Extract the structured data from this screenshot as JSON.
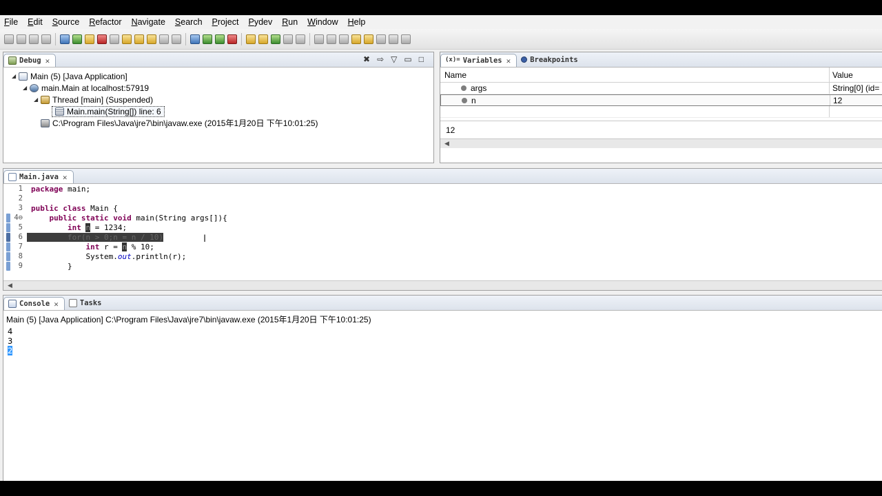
{
  "menu": [
    "File",
    "Edit",
    "Source",
    "Refactor",
    "Navigate",
    "Search",
    "Project",
    "Pydev",
    "Run",
    "Window",
    "Help"
  ],
  "debug_view": {
    "tab_label": "Debug",
    "tree": [
      {
        "label": "Main (5) [Java Application]"
      },
      {
        "label": "main.Main at localhost:57919"
      },
      {
        "label": "Thread [main] (Suspended)"
      },
      {
        "label": "Main.main(String[]) line: 6"
      },
      {
        "label": "C:\\Program Files\\Java\\jre7\\bin\\javaw.exe (2015年1月20日 下午10:01:25)"
      }
    ]
  },
  "variables_view": {
    "tab_label": "Variables",
    "breakpoints_label": "Breakpoints",
    "col_name": "Name",
    "col_value": "Value",
    "rows": [
      {
        "name": "args",
        "value": "String[0]  (id="
      },
      {
        "name": "n",
        "value": "12"
      }
    ],
    "detail": "12"
  },
  "editor": {
    "tab_label": "Main.java",
    "lines": [
      {
        "num": "1",
        "text": "package main;"
      },
      {
        "num": "2",
        "text": ""
      },
      {
        "num": "3",
        "pre": "public class",
        "text": " Main {"
      },
      {
        "num": "4⊖",
        "pre": "    public static void",
        "text": " main(String args[]){"
      },
      {
        "num": "5",
        "pre": "        int",
        "mid": " ",
        "hl": "n",
        "text": " = 1234;"
      },
      {
        "num": "6",
        "text": "        for(n > 0;n = n / 10)"
      },
      {
        "num": "7",
        "pre": "            int",
        "text": " r = ",
        "hl": "n",
        "post": " % 10;"
      },
      {
        "num": "8",
        "pre": "            System.",
        "it": "out",
        "post": ".println(r);"
      },
      {
        "num": "9",
        "text": "        }"
      }
    ]
  },
  "console_view": {
    "tab_label": "Console",
    "tasks_label": "Tasks",
    "title": "Main (5) [Java Application] C:\\Program Files\\Java\\jre7\\bin\\javaw.exe (2015年1月20日 下午10:01:25)",
    "output": [
      "4",
      "3",
      "2"
    ]
  },
  "colors": {
    "keyword": "#7f0055",
    "selection": "#3399ff",
    "current_line": "#3d3d3d"
  }
}
